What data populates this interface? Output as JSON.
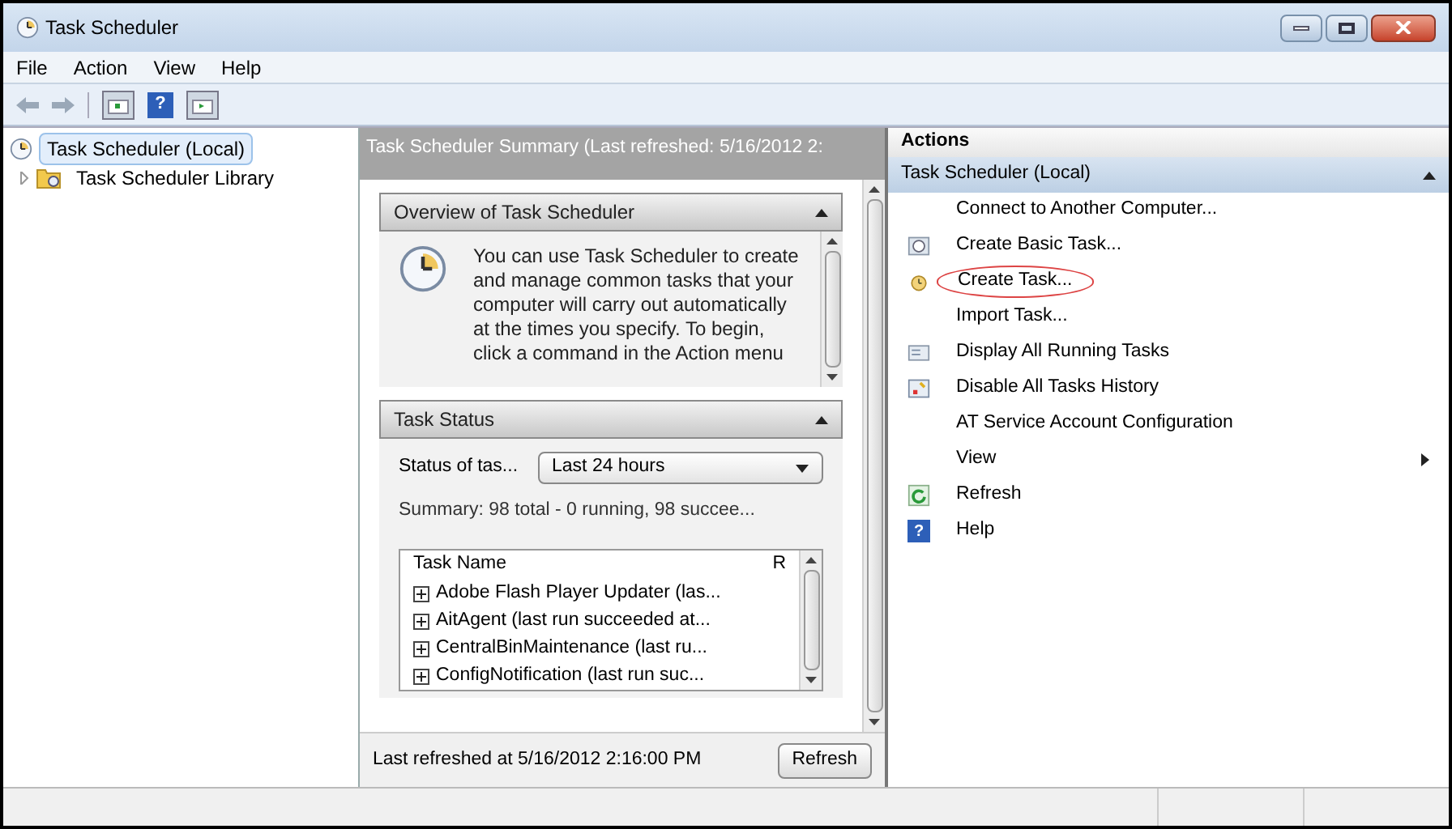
{
  "window": {
    "title": "Task Scheduler"
  },
  "menu": [
    "File",
    "Action",
    "View",
    "Help"
  ],
  "toolbar": {
    "help_glyph": "?"
  },
  "tree": [
    {
      "label": "Task Scheduler (Local)",
      "selected": true,
      "children": [
        {
          "label": "Task Scheduler Library",
          "selected": false,
          "expanded": false
        }
      ]
    }
  ],
  "summary": {
    "header": "Task Scheduler Summary (Last refreshed: 5/16/2012 2:",
    "overview": {
      "title": "Overview of Task Scheduler",
      "expanded": true,
      "text": "You can use Task Scheduler to create and manage common tasks that your computer will carry out automatically at the times you specify. To begin, click a command in the Action menu"
    },
    "status": {
      "title": "Task Status",
      "expanded": true,
      "label": "Status of tas...",
      "dropdown": "Last 24 hours",
      "summary": "Summary: 98 total - 0 running, 98 succee...",
      "columns": [
        "Task Name",
        "R"
      ],
      "rows": [
        "Adobe Flash Player Updater (las...",
        "AitAgent (last run succeeded at...",
        "CentralBinMaintenance (last ru...",
        "ConfigNotification (last run suc..."
      ]
    },
    "footer": "Last refreshed at 5/16/2012 2:16:00 PM",
    "refresh_button": "Refresh"
  },
  "actions": {
    "title": "Actions",
    "group": "Task Scheduler (Local)",
    "expanded": true,
    "items": [
      {
        "label": "Connect to Another Computer...",
        "kind": "none",
        "submenu": false,
        "highlighted": false
      },
      {
        "label": "Create Basic Task...",
        "kind": "basic",
        "submenu": false,
        "highlighted": false
      },
      {
        "label": "Create Task...",
        "kind": "create",
        "submenu": false,
        "highlighted": true
      },
      {
        "label": "Import Task...",
        "kind": "none",
        "submenu": false,
        "highlighted": false
      },
      {
        "label": "Display All Running Tasks",
        "kind": "display",
        "submenu": false,
        "highlighted": false
      },
      {
        "label": "Disable All Tasks History",
        "kind": "disable",
        "submenu": false,
        "highlighted": false
      },
      {
        "label": "AT Service Account Configuration",
        "kind": "none",
        "submenu": false,
        "highlighted": false
      },
      {
        "label": "View",
        "kind": "none",
        "submenu": true,
        "highlighted": false
      },
      {
        "label": "Refresh",
        "kind": "refresh",
        "submenu": false,
        "highlighted": false
      },
      {
        "label": "Help",
        "kind": "help",
        "glyph": "?",
        "submenu": false,
        "highlighted": false
      }
    ]
  }
}
